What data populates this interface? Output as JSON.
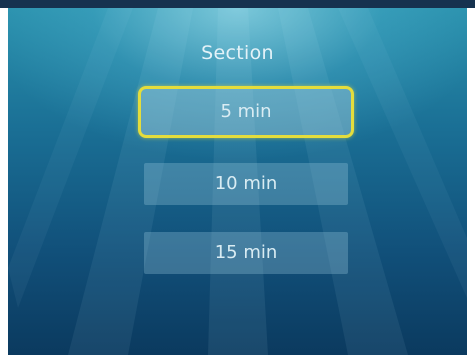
{
  "menu": {
    "title": "Section",
    "options": [
      {
        "label": "5 min",
        "selected": true
      },
      {
        "label": "10 min",
        "selected": false
      },
      {
        "label": "15 min",
        "selected": false
      }
    ]
  },
  "colors": {
    "highlight": "#e4dd3c",
    "background_top": "#2a91ad",
    "background_bottom": "#0b3a5f"
  }
}
